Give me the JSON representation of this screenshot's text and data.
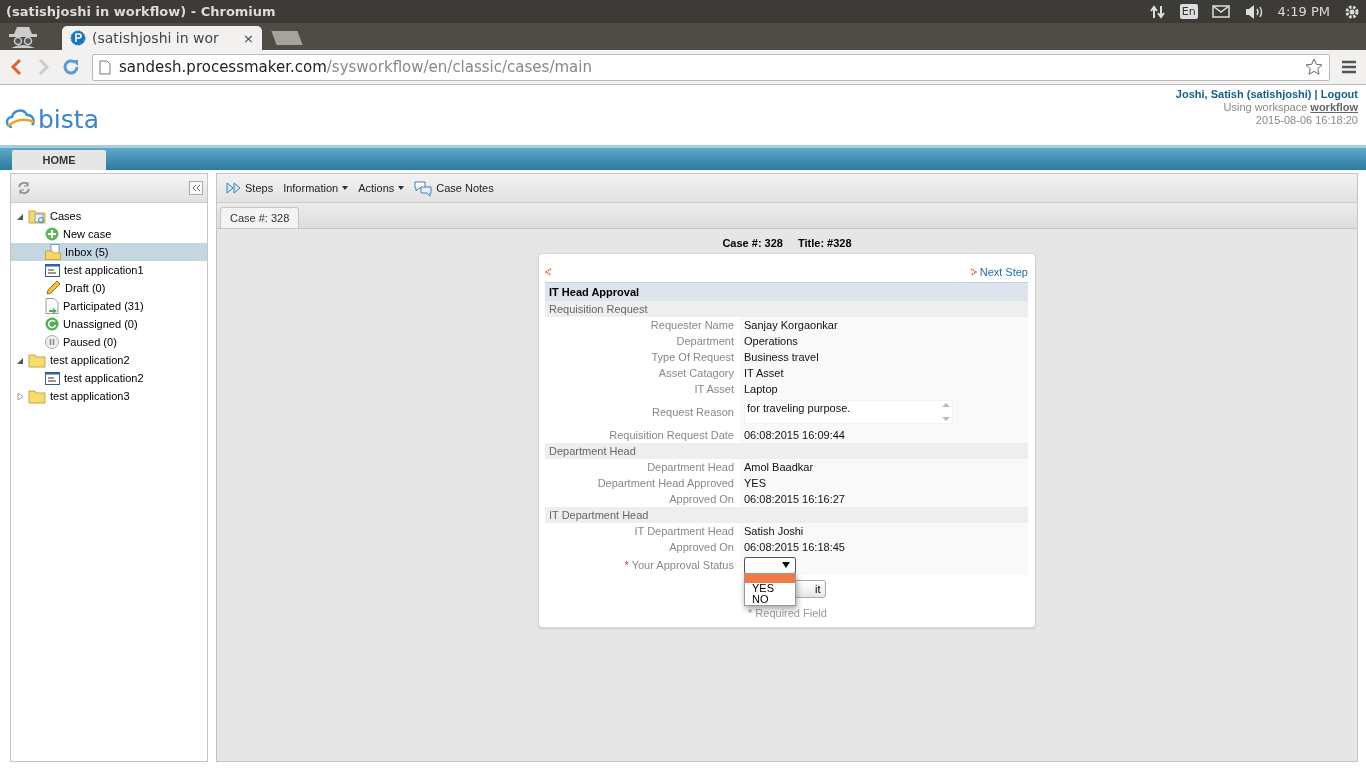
{
  "os_bar": {
    "title": "(satishjoshi in workflow) - Chromium",
    "keyboard": "En",
    "clock": "4:19 PM"
  },
  "browser": {
    "tab_title": "(satishjoshi in wor",
    "tab_close": "×",
    "url_host": "sandesh.processmaker.com",
    "url_path": "/sysworkflow/en/classic/cases/main"
  },
  "header": {
    "logo": "bista",
    "user": "Joshi, Satish (satishjoshi)",
    "separator": "|",
    "logout": "Logout",
    "workspace_label": "Using workspace",
    "workspace": "workflow",
    "datetime": "2015-08-06 16:18:20"
  },
  "nav_tabs": [
    {
      "label": "HOME",
      "selected": true
    }
  ],
  "sidebar": {
    "tree": [
      {
        "label": "Cases",
        "kind": "cases",
        "expanded": true,
        "selected": false,
        "children": [
          {
            "label": "New case",
            "kind": "new",
            "selected": false
          },
          {
            "label": "Inbox (5)",
            "kind": "inbox",
            "selected": true
          },
          {
            "label": "test application1",
            "kind": "form",
            "selected": false
          },
          {
            "label": "Draft (0)",
            "kind": "draft",
            "selected": false
          },
          {
            "label": "Participated (31)",
            "kind": "participated",
            "selected": false
          },
          {
            "label": "Unassigned (0)",
            "kind": "unassigned",
            "selected": false
          },
          {
            "label": "Paused (0)",
            "kind": "paused",
            "selected": false
          }
        ]
      },
      {
        "label": "test application2",
        "kind": "folder",
        "expanded": true,
        "selected": false,
        "children": [
          {
            "label": "test application2",
            "kind": "form",
            "selected": false
          }
        ]
      },
      {
        "label": "test application3",
        "kind": "folder",
        "expanded": false,
        "selected": false
      }
    ]
  },
  "toolbar": [
    {
      "label": "Steps",
      "kind": "steps"
    },
    {
      "label": "Information",
      "kind": "menu"
    },
    {
      "label": "Actions",
      "kind": "menu"
    },
    {
      "label": "Case Notes",
      "kind": "notes"
    }
  ],
  "case_tabs": [
    {
      "label": "Case #: 328",
      "selected": true
    }
  ],
  "case_header": {
    "case": "Case #: 328",
    "title": "Title: #328"
  },
  "form": {
    "next_step": "Next Step",
    "title": "IT Head Approval",
    "rows": [
      {
        "kind": "section",
        "label": "Requisition Request"
      },
      {
        "kind": "field",
        "label": "Requester Name",
        "value": "Sanjay Korgaonkar"
      },
      {
        "kind": "field",
        "label": "Department",
        "value": "Operations"
      },
      {
        "kind": "field",
        "label": "Type Of Request",
        "value": "Business travel"
      },
      {
        "kind": "field",
        "label": "Asset Catagory",
        "value": "IT Asset"
      },
      {
        "kind": "field",
        "label": "IT Asset",
        "value": "Laptop"
      },
      {
        "kind": "textarea",
        "label": "Request Reason",
        "value": "for traveling purpose."
      },
      {
        "kind": "field",
        "label": "Requisition Request Date",
        "value": "06:08:2015 16:09:44"
      },
      {
        "kind": "section",
        "label": "Department Head"
      },
      {
        "kind": "field",
        "label": "Department Head",
        "value": "Amol Baadkar"
      },
      {
        "kind": "field",
        "label": "Department Head Approved",
        "value": "YES"
      },
      {
        "kind": "field",
        "label": "Approved On",
        "value": "06:08:2015 16:16:27"
      },
      {
        "kind": "section",
        "label": "IT Department Head"
      },
      {
        "kind": "field",
        "label": "IT Department Head",
        "value": "Satish Joshi"
      },
      {
        "kind": "field",
        "label": "Approved On",
        "value": "06:08:2015 16:18:45"
      },
      {
        "kind": "select",
        "required_mark": "*",
        "label": "Your Approval Status",
        "options": [
          "YES",
          "NO"
        ]
      }
    ],
    "submit_button": "it",
    "required_note": "* Required Field"
  }
}
